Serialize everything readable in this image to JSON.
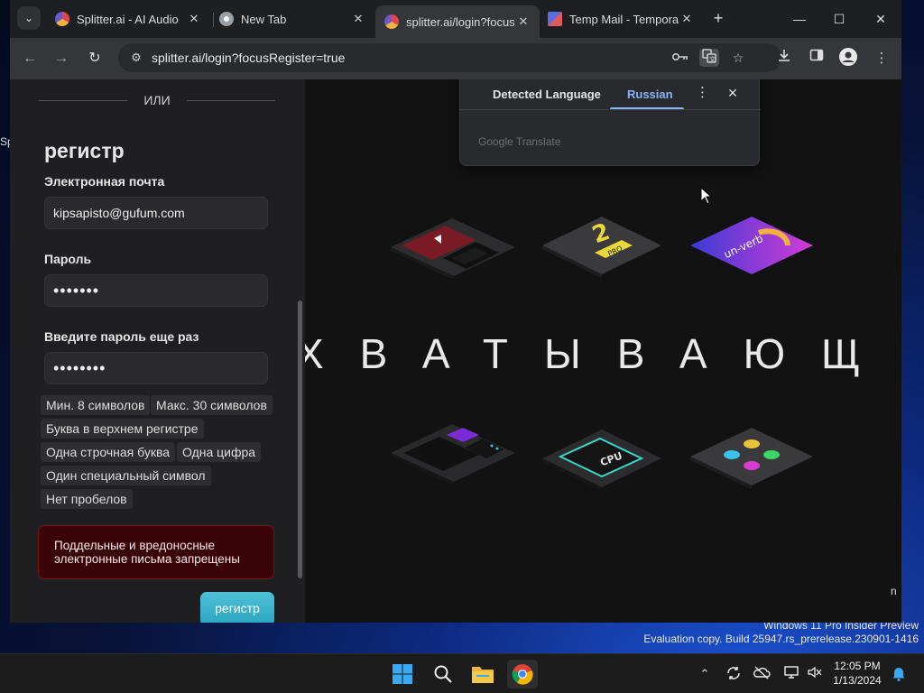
{
  "desktop": {
    "edge_text": "Sp",
    "watermark_line1": "Windows 11 Pro Insider Preview",
    "watermark_line2": "Evaluation copy. Build 25947.rs_prerelease.230901-1416"
  },
  "browser": {
    "tabs": [
      {
        "title": "Splitter.ai - AI Audio",
        "close": "✕",
        "favicon_color": "#e0474c"
      },
      {
        "title": "New Tab",
        "close": "✕",
        "favicon_color": "#9aa0a6"
      },
      {
        "title": "splitter.ai/login?focus",
        "close": "✕",
        "favicon_color": "#e0474c"
      },
      {
        "title": "Temp Mail - Tempora",
        "close": "✕",
        "favicon_color": "#5b6ee1"
      }
    ],
    "new_tab": "+",
    "window_controls": {
      "minimize": "—",
      "maximize": "☐",
      "close": "✕"
    },
    "url": "splitter.ai/login?focusRegister=true"
  },
  "form": {
    "divider_text": "ИЛИ",
    "title": "регистр",
    "email_label": "Электронная почта",
    "email_value": "kipsapisto@gufum.com",
    "password_label": "Пароль",
    "password_value": "•••••••",
    "confirm_label": "Введите пароль еще раз",
    "confirm_value": "••••••••",
    "requirements": [
      "Мин. 8 символов",
      "Макс. 30 символов",
      "Буква в верхнем регистре",
      "Одна строчная буква",
      "Одна цифра",
      "Один специальный символ",
      "Нет пробелов"
    ],
    "warning": "Поддельные и вредоносные электронные письма запрещены",
    "submit": "регистр"
  },
  "showcase": {
    "marquee": "ХВАТЫВАЮЩ",
    "tiles": [
      {
        "name": "youtube-tile-icon",
        "colors": [
          "#8a1c26",
          "#333"
        ]
      },
      {
        "name": "pro-tile-icon",
        "label": "PRO"
      },
      {
        "name": "unverb-tile-icon",
        "label": "un-verb"
      },
      {
        "name": "keyboard-tile-icon",
        "colors": [
          "#7a2bd6",
          "#333"
        ]
      },
      {
        "name": "cpu-tile-icon",
        "label": "CPU"
      },
      {
        "name": "controller-tile-icon",
        "colors": [
          "#e8c33b",
          "#3bd66a",
          "#d83bd0",
          "#3bc2e8"
        ]
      }
    ]
  },
  "translate_popup": {
    "tab_detected": "Detected Language",
    "tab_target": "Russian",
    "more": "⋮",
    "close": "✕",
    "brand": "Google Translate"
  },
  "page_edge_text": "n",
  "taskbar": {
    "time": "12:05 PM",
    "date": "1/13/2024"
  }
}
